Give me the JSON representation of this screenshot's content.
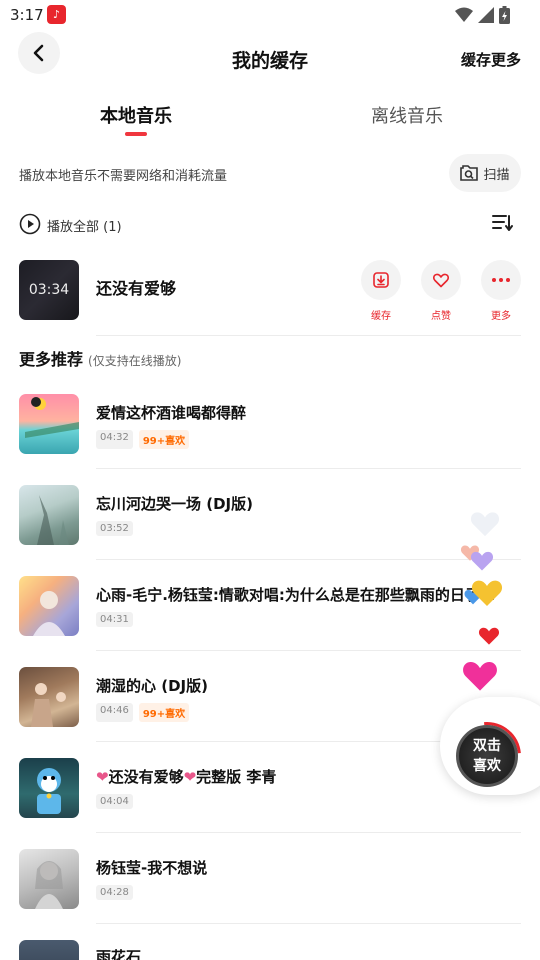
{
  "status_bar": {
    "time": "3:17"
  },
  "header": {
    "title": "我的缓存",
    "cache_more": "缓存更多"
  },
  "tabs": [
    {
      "label": "本地音乐",
      "active": true
    },
    {
      "label": "离线音乐",
      "active": false
    }
  ],
  "info": {
    "text": "播放本地音乐不需要网络和消耗流量",
    "scan_label": "扫描"
  },
  "play_all": {
    "label": "播放全部 (1)"
  },
  "local_songs": [
    {
      "title": "还没有爱够",
      "cover_text": "03:34",
      "actions": [
        "缓存",
        "点赞",
        "更多"
      ]
    }
  ],
  "recommend": {
    "title": "更多推荐",
    "subtitle": "(仅支持在线播放)",
    "items": [
      {
        "title": "爱情这杯酒谁喝都得醉",
        "duration": "04:32",
        "badge": "99+喜欢"
      },
      {
        "title": "忘川河边哭一场 (DJ版)",
        "duration": "03:52",
        "badge": ""
      },
      {
        "title": "心雨-毛宁.杨钰莹:情歌对唱:为什么总是在那些飘雨的日子…",
        "duration": "04:31",
        "badge": ""
      },
      {
        "title": "潮湿的心 (DJ版)",
        "duration": "04:46",
        "badge": "99+喜欢"
      },
      {
        "title": "还没有爱够",
        "title_suffix": "完整版 李青",
        "heart": "❤",
        "duration": "04:04",
        "badge": ""
      },
      {
        "title": "杨钰莹-我不想说",
        "duration": "04:28",
        "badge": ""
      },
      {
        "title": "雨花石",
        "duration": "",
        "badge": ""
      }
    ]
  },
  "double_like": {
    "line1": "双击",
    "line2": "喜欢"
  },
  "colors": {
    "accent": "#e8262d",
    "badge": "#ff6a00"
  }
}
